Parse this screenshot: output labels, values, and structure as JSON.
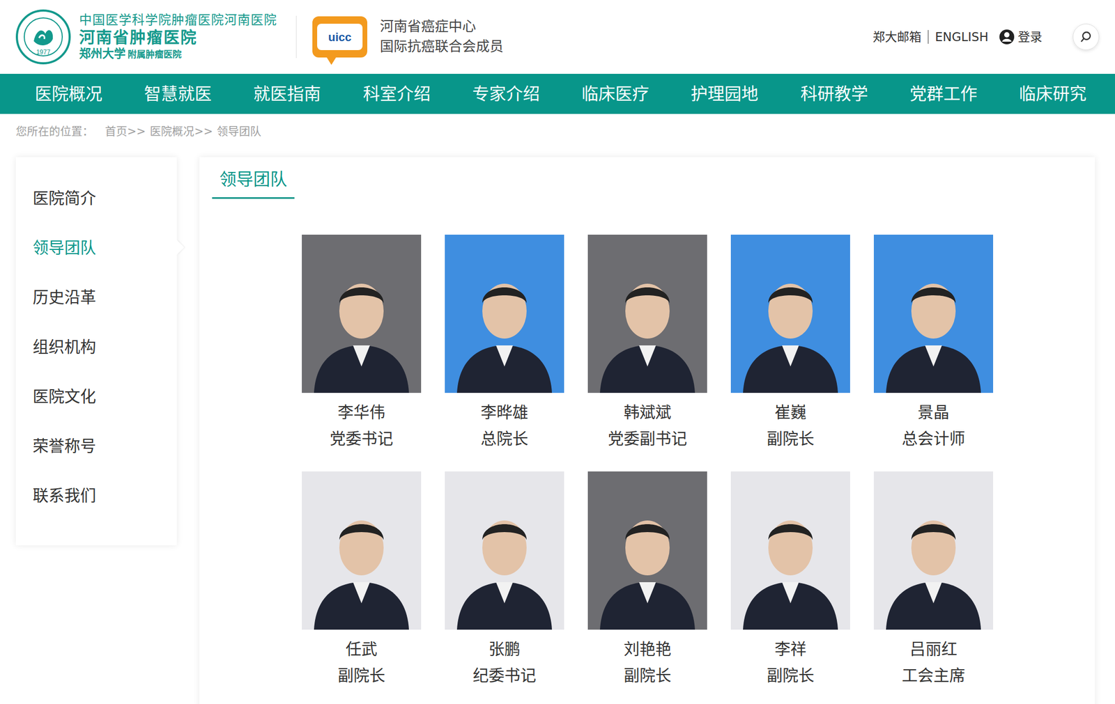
{
  "header": {
    "logo_lines": [
      "中国医学科学院肿瘤医院河南医院",
      "河南省肿瘤医院",
      "郑州大学",
      "附属肿瘤医院"
    ],
    "emblem_year": "1977",
    "uicc": "uicc",
    "affiliation": [
      "河南省癌症中心",
      "国际抗癌联合会成员"
    ],
    "top_links": [
      "郑大邮箱",
      "ENGLISH"
    ],
    "login": "登录"
  },
  "nav": [
    "医院概况",
    "智慧就医",
    "就医指南",
    "科室介绍",
    "专家介绍",
    "临床医疗",
    "护理园地",
    "科研教学",
    "党群工作",
    "临床研究"
  ],
  "breadcrumb": {
    "prefix": "您所在的位置：",
    "separator": ">>",
    "items": [
      "首页",
      "医院概况",
      "领导团队"
    ]
  },
  "sidebar": {
    "items": [
      {
        "label": "医院简介",
        "selected": false
      },
      {
        "label": "领导团队",
        "selected": true
      },
      {
        "label": "历史沿革",
        "selected": false
      },
      {
        "label": "组织机构",
        "selected": false
      },
      {
        "label": "医院文化",
        "selected": false
      },
      {
        "label": "荣誉称号",
        "selected": false
      },
      {
        "label": "联系我们",
        "selected": false
      }
    ]
  },
  "section_title": "领导团队",
  "leaders": [
    {
      "name": "李华伟",
      "title": "党委书记"
    },
    {
      "name": "李晔雄",
      "title": "总院长"
    },
    {
      "name": "韩斌斌",
      "title": "党委副书记"
    },
    {
      "name": "崔巍",
      "title": "副院长"
    },
    {
      "name": "景晶",
      "title": "总会计师"
    },
    {
      "name": "任武",
      "title": "副院长"
    },
    {
      "name": "张鹏",
      "title": "纪委书记"
    },
    {
      "name": "刘艳艳",
      "title": "副院长"
    },
    {
      "name": "李祥",
      "title": "副院长"
    },
    {
      "name": "吕丽红",
      "title": "工会主席"
    }
  ]
}
